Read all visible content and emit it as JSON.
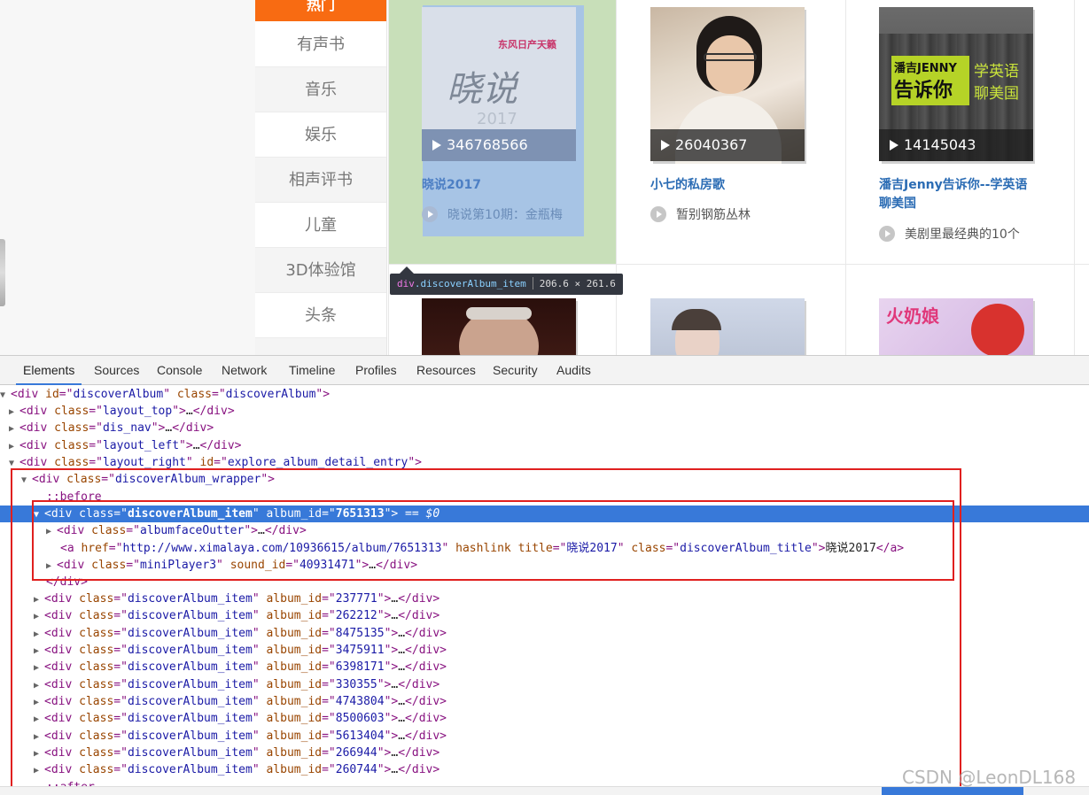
{
  "categories": {
    "hot": "热门",
    "items": [
      "有声书",
      "音乐",
      "娱乐",
      "相声评书",
      "儿童",
      "3D体验馆",
      "头条"
    ]
  },
  "albums": [
    {
      "plays": "346768566",
      "title": "晓说2017",
      "sub": "晓说第10期：金瓶梅",
      "cover_text": "东风日产天籁",
      "cover_logo": "晓说"
    },
    {
      "plays": "26040367",
      "title": "小七的私房歌",
      "sub": "暂别钢筋丛林"
    },
    {
      "plays": "14145043",
      "title": "潘吉Jenny告诉你--学英语聊美国",
      "sub": "美剧里最经典的10个",
      "cover_text_1": "潘吉JENNY",
      "cover_text_2": "告诉你",
      "cover_text_3": "学英语",
      "cover_text_4": "聊美国"
    }
  ],
  "tooltip": {
    "tag": "div",
    "cls": ".discoverAlbum_item",
    "size": "206.6 × 261.6"
  },
  "devtools": {
    "tabs": [
      "Elements",
      "Sources",
      "Console",
      "Network",
      "Timeline",
      "Profiles",
      "Resources",
      "Security",
      "Audits"
    ],
    "active_tab": "Elements"
  },
  "dom": {
    "r0": {
      "id": "discoverAlbum",
      "cls": "discoverAlbum"
    },
    "r1": "layout_top",
    "r2": "dis_nav",
    "r3": "layout_left",
    "r4": {
      "cls": "layout_right",
      "id": "explore_album_detail_entry"
    },
    "r5": "discoverAlbum_wrapper",
    "before": "::before",
    "sel": {
      "cls": "discoverAlbum_item",
      "album_id": "7651313",
      "marker": "== $0"
    },
    "face": "albumfaceOutter",
    "link": {
      "href": "http://www.ximalaya.com/10936615/album/7651313",
      "title": "晓说2017",
      "cls": "discoverAlbum_title",
      "text": "晓说2017"
    },
    "player": {
      "cls": "miniPlayer3",
      "sound_id": "40931471"
    },
    "close_div": "</div>",
    "item_cls": "discoverAlbum_item",
    "items": [
      "237771",
      "262212",
      "8475135",
      "3475911",
      "6398171",
      "330355",
      "4743804",
      "8500603",
      "5613404",
      "266944",
      "260744"
    ],
    "after": "::after"
  },
  "watermark": "CSDN @LeonDL168"
}
